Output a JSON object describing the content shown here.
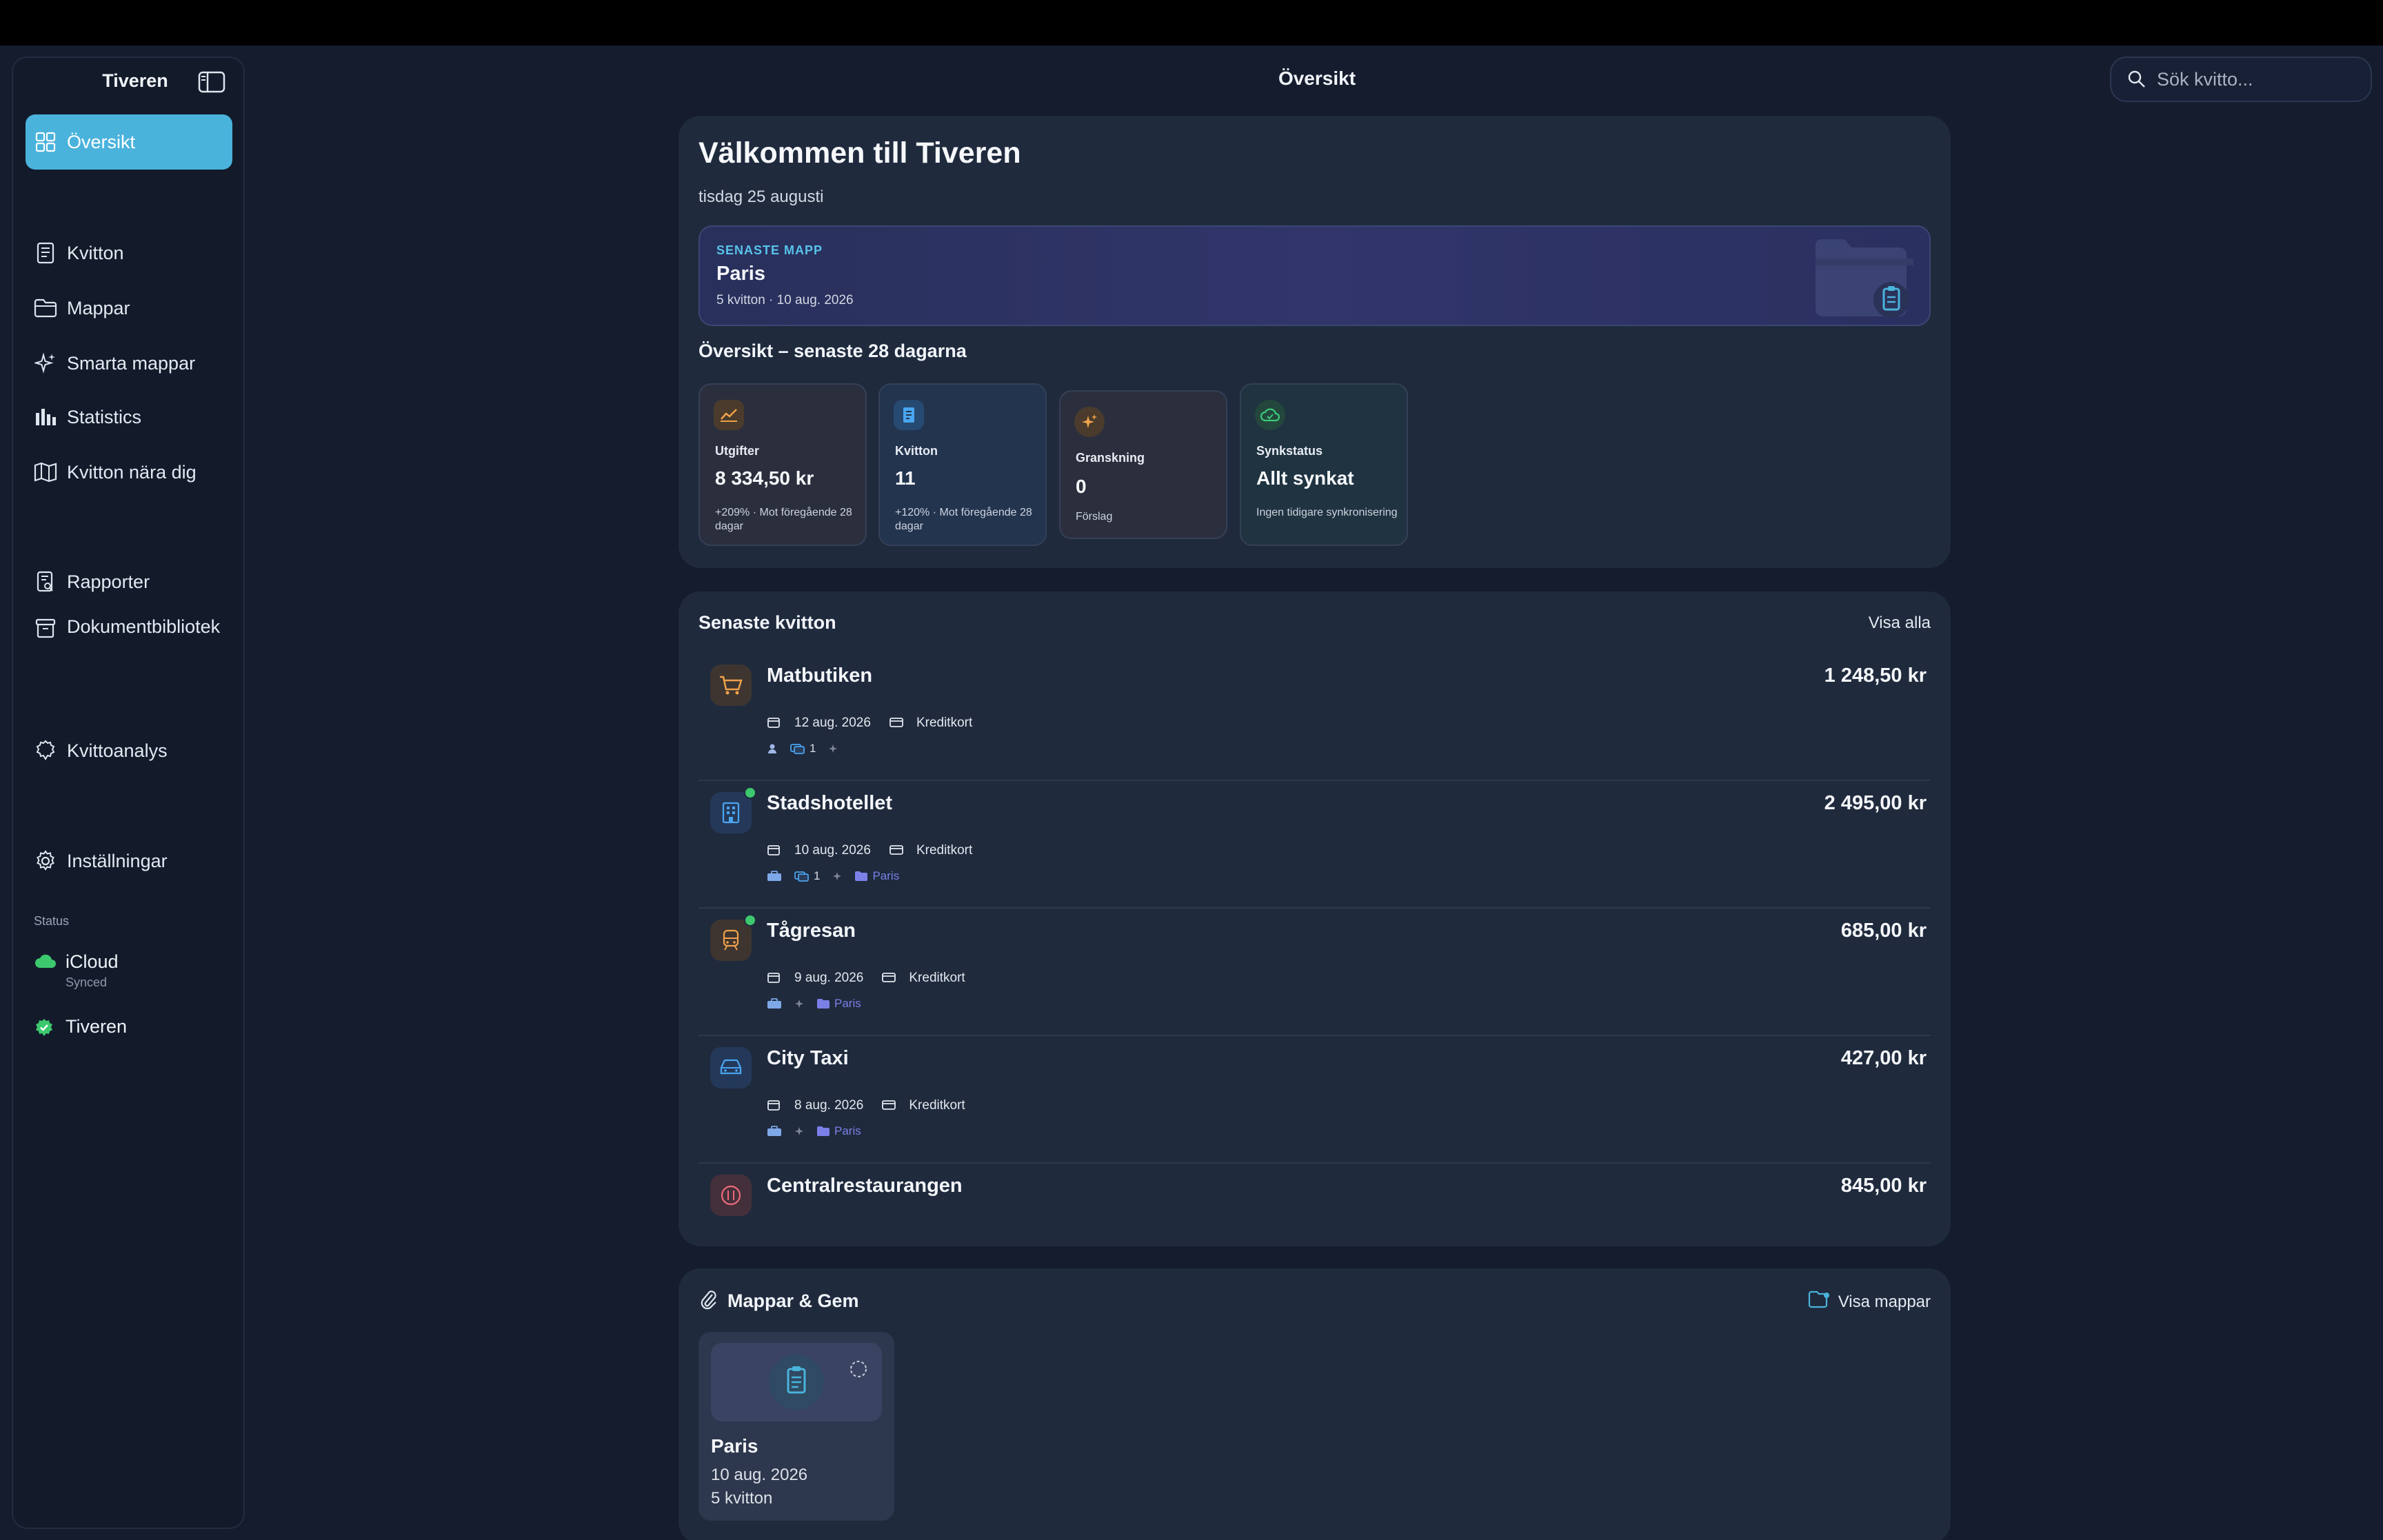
{
  "sidebar": {
    "title": "Tiveren",
    "nav": {
      "overview": "Översikt",
      "receipts": "Kvitton",
      "folders": "Mappar",
      "smart_folders": "Smarta mappar",
      "statistics": "Statistics",
      "nearby": "Kvitton nära dig",
      "reports": "Rapporter",
      "docs": "Dokumentbibliotek",
      "analysis": "Kvittoanalys",
      "settings": "Inställningar"
    },
    "status": {
      "label": "Status",
      "icloud": "iCloud",
      "icloud_sub": "Synced",
      "tiveren": "Tiveren"
    }
  },
  "header": {
    "title": "Översikt",
    "search_placeholder": "Sök kvitto..."
  },
  "welcome": {
    "title": "Välkommen till Tiveren",
    "date": "tisdag 25 augusti",
    "latest_folder": {
      "kicker": "SENASTE MAPP",
      "name": "Paris",
      "meta": "5 kvitton · 10 aug. 2026"
    },
    "overview_title": "Översikt – senaste 28 dagarna",
    "stats": [
      {
        "label": "Utgifter",
        "value": "8 334,50 kr",
        "sub": "+209% · Mot föregående 28 dagar",
        "icon": "chart-icon",
        "color": "#f0a24a"
      },
      {
        "label": "Kvitton",
        "value": "11",
        "sub": "+120% · Mot föregående 28 dagar",
        "icon": "receipt-icon",
        "color": "#4aa5f0"
      },
      {
        "label": "Granskning",
        "value": "0",
        "sub": "Förslag",
        "icon": "sparkle-icon",
        "color": "#f0a24a"
      },
      {
        "label": "Synkstatus",
        "value": "Allt synkat",
        "sub": "Ingen tidigare synkronisering",
        "icon": "cloud-icon",
        "color": "#3dc87a"
      }
    ]
  },
  "recent": {
    "title": "Senaste kvitton",
    "view_all": "Visa alla",
    "items": [
      {
        "name": "Matbutiken",
        "amount": "1 248,50 kr",
        "date": "12 aug. 2026",
        "payment": "Kreditkort",
        "tag_count": "1",
        "folder": "",
        "icon": "cart-icon"
      },
      {
        "name": "Stadshotellet",
        "amount": "2 495,00 kr",
        "date": "10 aug. 2026",
        "payment": "Kreditkort",
        "tag_count": "1",
        "folder": "Paris",
        "icon": "hotel-icon"
      },
      {
        "name": "Tågresan",
        "amount": "685,00 kr",
        "date": "9 aug. 2026",
        "payment": "Kreditkort",
        "tag_count": "",
        "folder": "Paris",
        "icon": "train-icon"
      },
      {
        "name": "City Taxi",
        "amount": "427,00 kr",
        "date": "8 aug. 2026",
        "payment": "Kreditkort",
        "tag_count": "",
        "folder": "Paris",
        "icon": "car-icon"
      },
      {
        "name": "Centralrestaurangen",
        "amount": "845,00 kr",
        "date": "",
        "payment": "",
        "tag_count": "",
        "folder": "",
        "icon": "restaurant-icon"
      }
    ]
  },
  "folders": {
    "title": "Mappar & Gem",
    "view_link": "Visa mappar",
    "items": [
      {
        "name": "Paris",
        "date": "10 aug. 2026",
        "count": "5 kvitton"
      }
    ]
  },
  "colors": {
    "accent": "#4ab3dc",
    "background": "#141c2d",
    "card": "#1f2a3d",
    "success": "#3dc86d",
    "folder_tag": "#7b80e8"
  }
}
